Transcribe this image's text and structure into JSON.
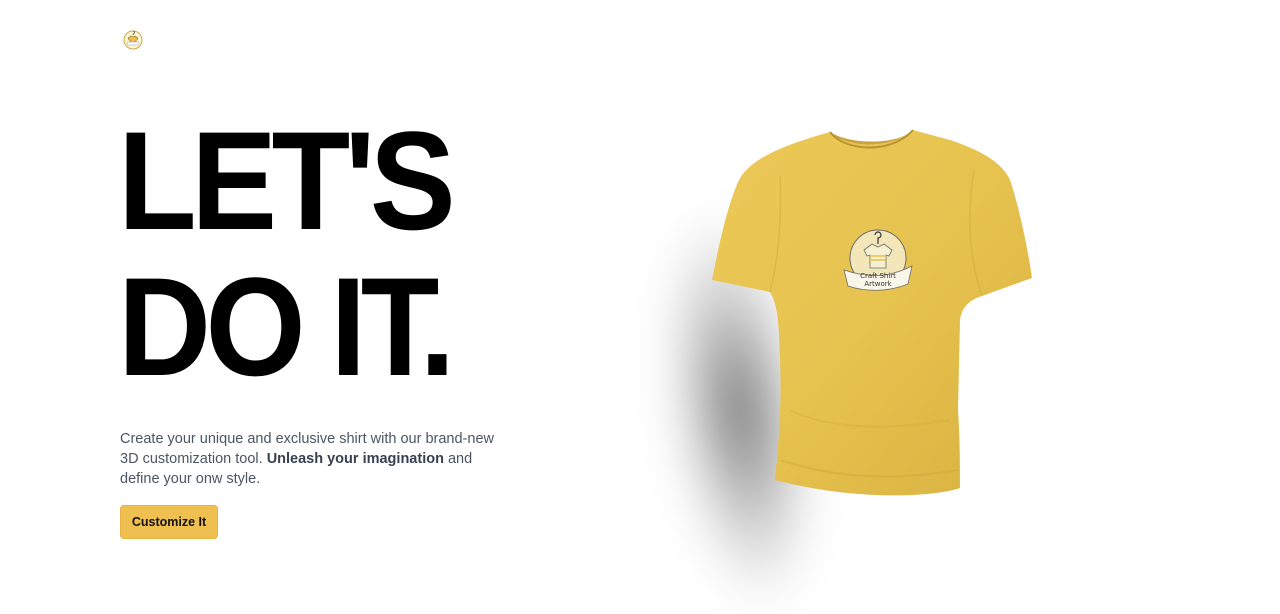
{
  "logo": {
    "icon": "shirt-logo-icon",
    "alt": "Craft Shirt Artwork logo"
  },
  "headline": {
    "line1": "LET'S",
    "line2": "DO IT."
  },
  "description": {
    "part1": "Create your unique and exclusive shirt with our brand-new 3D customization tool. ",
    "strong": "Unleash your imagination",
    "part2": " and define your onw style."
  },
  "cta": {
    "label": "Customize It"
  },
  "shirt": {
    "color": "#e6c24f",
    "logo_line1": "Craft Shirt",
    "logo_line2": "Artwork"
  },
  "colors": {
    "accent": "#efc050",
    "text_muted": "#4b5563"
  }
}
